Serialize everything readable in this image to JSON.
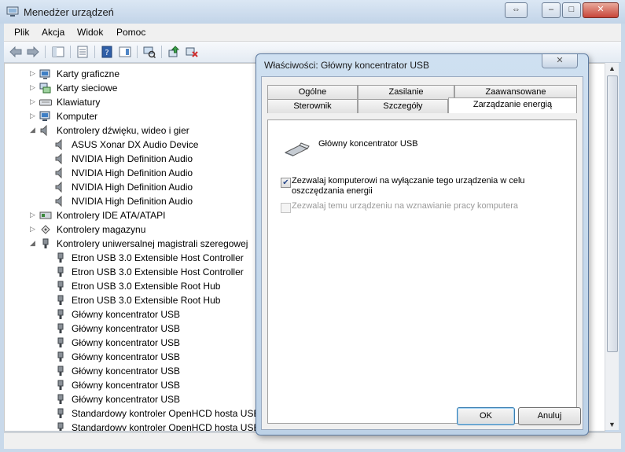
{
  "window": {
    "title": "Menedżer urządzeń",
    "controls": [
      "⇔",
      "–",
      "□",
      "✕"
    ]
  },
  "menu": [
    "Plik",
    "Akcja",
    "Widok",
    "Pomoc"
  ],
  "toolbar": {
    "buttons": [
      "back-arrow-icon",
      "forward-arrow-icon",
      "show-hide-tree-icon",
      "properties-icon",
      "help-icon",
      "action-pane-icon",
      "scan-hardware-icon",
      "update-driver-icon",
      "uninstall-device-icon"
    ]
  },
  "tree": {
    "items": [
      {
        "label": "Karty graficzne",
        "level": 1,
        "expander": "▷",
        "icon": "display-adapter-icon"
      },
      {
        "label": "Karty sieciowe",
        "level": 1,
        "expander": "▷",
        "icon": "network-adapter-icon"
      },
      {
        "label": "Klawiatury",
        "level": 1,
        "expander": "▷",
        "icon": "keyboard-icon"
      },
      {
        "label": "Komputer",
        "level": 1,
        "expander": "▷",
        "icon": "computer-icon"
      },
      {
        "label": "Kontrolery dźwięku, wideo i gier",
        "level": 1,
        "expander": "◢",
        "icon": "speaker-icon"
      },
      {
        "label": "ASUS Xonar DX Audio Device",
        "level": 2,
        "expander": "",
        "icon": "speaker-icon"
      },
      {
        "label": "NVIDIA High Definition Audio",
        "level": 2,
        "expander": "",
        "icon": "speaker-icon"
      },
      {
        "label": "NVIDIA High Definition Audio",
        "level": 2,
        "expander": "",
        "icon": "speaker-icon"
      },
      {
        "label": "NVIDIA High Definition Audio",
        "level": 2,
        "expander": "",
        "icon": "speaker-icon"
      },
      {
        "label": "NVIDIA High Definition Audio",
        "level": 2,
        "expander": "",
        "icon": "speaker-icon"
      },
      {
        "label": "Kontrolery IDE ATA/ATAPI",
        "level": 1,
        "expander": "▷",
        "icon": "ide-controller-icon"
      },
      {
        "label": "Kontrolery magazynu",
        "level": 1,
        "expander": "▷",
        "icon": "storage-controller-icon"
      },
      {
        "label": "Kontrolery uniwersalnej magistrali szeregowej",
        "level": 1,
        "expander": "◢",
        "icon": "usb-icon"
      },
      {
        "label": "Etron USB 3.0 Extensible Host Controller",
        "level": 2,
        "expander": "",
        "icon": "usb-icon"
      },
      {
        "label": "Etron USB 3.0 Extensible Host Controller",
        "level": 2,
        "expander": "",
        "icon": "usb-icon"
      },
      {
        "label": "Etron USB 3.0 Extensible Root Hub",
        "level": 2,
        "expander": "",
        "icon": "usb-icon"
      },
      {
        "label": "Etron USB 3.0 Extensible Root Hub",
        "level": 2,
        "expander": "",
        "icon": "usb-icon"
      },
      {
        "label": "Główny koncentrator USB",
        "level": 2,
        "expander": "",
        "icon": "usb-icon"
      },
      {
        "label": "Główny koncentrator USB",
        "level": 2,
        "expander": "",
        "icon": "usb-icon"
      },
      {
        "label": "Główny koncentrator USB",
        "level": 2,
        "expander": "",
        "icon": "usb-icon"
      },
      {
        "label": "Główny koncentrator USB",
        "level": 2,
        "expander": "",
        "icon": "usb-icon"
      },
      {
        "label": "Główny koncentrator USB",
        "level": 2,
        "expander": "",
        "icon": "usb-icon"
      },
      {
        "label": "Główny koncentrator USB",
        "level": 2,
        "expander": "",
        "icon": "usb-icon"
      },
      {
        "label": "Główny koncentrator USB",
        "level": 2,
        "expander": "",
        "icon": "usb-icon"
      },
      {
        "label": "Standardowy kontroler OpenHCD hosta USB",
        "level": 2,
        "expander": "",
        "icon": "usb-icon"
      },
      {
        "label": "Standardowy kontroler OpenHCD hosta USB",
        "level": 2,
        "expander": "",
        "icon": "usb-icon"
      }
    ]
  },
  "dialog": {
    "title": "Właściwości: Główny koncentrator USB",
    "close": "✕",
    "tabs_row1": [
      "Ogólne",
      "Zasilanie",
      "Zaawansowane"
    ],
    "tabs_row2": [
      "Sterownik",
      "Szczegóły",
      "Zarządzanie energią"
    ],
    "device_name": "Główny koncentrator USB",
    "options": [
      {
        "label_line1": "Zezwalaj komputerowi na wyłączanie tego urządzenia w celu",
        "label_line2": "oszczędzania energii",
        "checked": true,
        "enabled": true
      },
      {
        "label_line1": "Zezwalaj temu urządzeniu na wznawianie pracy komputera",
        "label_line2": "",
        "checked": false,
        "enabled": false
      }
    ],
    "buttons": {
      "ok": "OK",
      "cancel": "Anuluj"
    }
  }
}
